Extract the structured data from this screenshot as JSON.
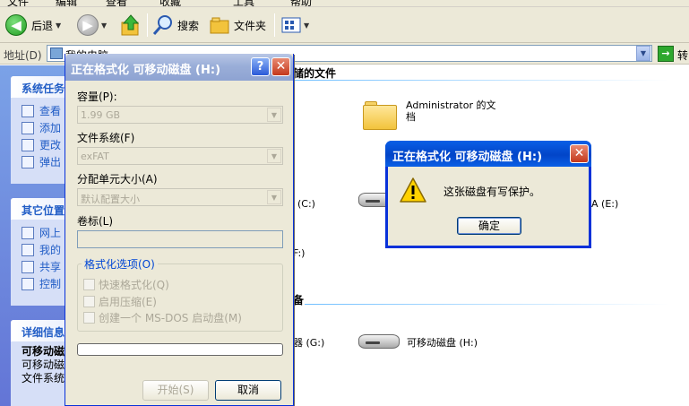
{
  "menubar": {
    "items": [
      "文件",
      "编辑",
      "查看",
      "收藏",
      "工具",
      "帮助"
    ]
  },
  "toolbar": {
    "back_label": "后退",
    "search_label": "搜索",
    "folders_label": "文件夹"
  },
  "address": {
    "label": "地址(D)",
    "value": "我的电脑",
    "go_label": "转"
  },
  "taskpane": {
    "system_tasks": {
      "title": "系统任务",
      "items": [
        "查看",
        "添加",
        "更改",
        "弹出"
      ]
    },
    "other_places": {
      "title": "其它位置",
      "items": [
        "网上",
        "我的",
        "共享",
        "控制"
      ]
    },
    "details": {
      "title": "详细信息",
      "name": "可移动磁",
      "type": "可移动磁",
      "fs": "文件系统"
    }
  },
  "content": {
    "stored_files_title": "储的文件",
    "admin_docs_line1": "Administrator 的文",
    "admin_docs_line2": "档",
    "drive_c_suffix": "(C:)",
    "drive_e_suffix": "A (E:)",
    "drive_f_suffix": "F:)",
    "removable_section_title": "备",
    "drive_g_suffix": "器 (G:)",
    "drive_h_label": "可移动磁盘 (H:)"
  },
  "format_dialog": {
    "title": "正在格式化 可移动磁盘 (H:)",
    "help_glyph": "?",
    "close_glyph": "✕",
    "capacity_label": "容量(P):",
    "capacity_value": "1.99 GB",
    "fs_label": "文件系统(F)",
    "fs_value": "exFAT",
    "alloc_label": "分配单元大小(A)",
    "alloc_value": "默认配置大小",
    "volume_label": "卷标(L)",
    "volume_value": "",
    "options_label": "格式化选项(O)",
    "options": [
      "快速格式化(Q)",
      "启用压缩(E)",
      "创建一个 MS-DOS 启动盘(M)"
    ],
    "progress": 0,
    "start_label": "开始(S)",
    "cancel_label": "取消"
  },
  "message_box": {
    "title": "正在格式化 可移动磁盘 (H:)",
    "close_glyph": "✕",
    "icon": "warning-icon",
    "text": "这张磁盘有写保护。",
    "ok_label": "确定"
  }
}
